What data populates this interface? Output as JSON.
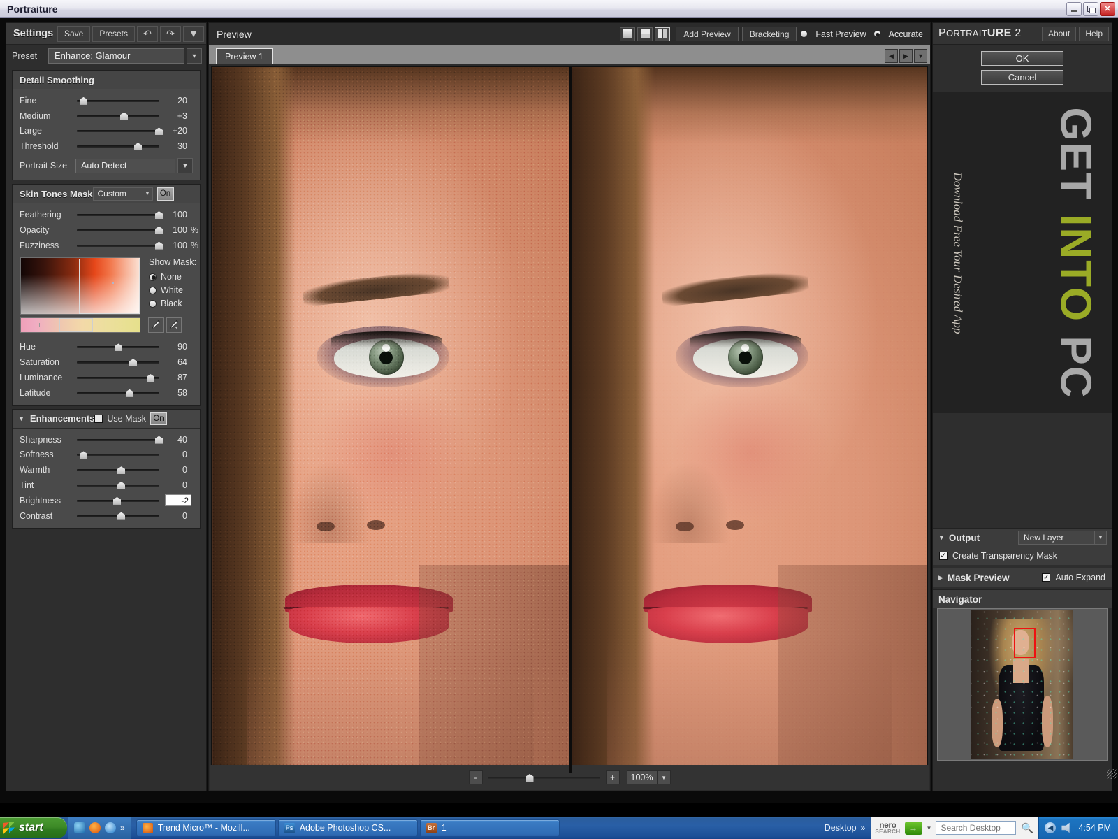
{
  "window": {
    "title": "Portraiture",
    "minimize_icon": "minimize-icon",
    "restore_icon": "restore-icon",
    "close_icon": "close-icon",
    "close_label": "✕"
  },
  "settings_panel": {
    "title": "Settings",
    "save_label": "Save",
    "presets_label": "Presets",
    "undo_icon": "↶",
    "redo_icon": "↷",
    "menu_icon": "▼",
    "preset_label": "Preset",
    "preset_value": "Enhance: Glamour",
    "detail_smoothing": {
      "title": "Detail Smoothing",
      "sliders": [
        {
          "label": "Fine",
          "value": "-20",
          "pos": 4
        },
        {
          "label": "Medium",
          "value": "+3",
          "pos": 62
        },
        {
          "label": "Large",
          "value": "+20",
          "pos": 112
        },
        {
          "label": "Threshold",
          "value": "30",
          "pos": 82
        }
      ],
      "portrait_size_label": "Portrait Size",
      "portrait_size_value": "Auto Detect"
    },
    "skin_tones_mask": {
      "title": "Skin Tones Mask",
      "mode": "Custom",
      "toggle": "On",
      "sliders": [
        {
          "label": "Feathering",
          "value": "100",
          "unit": "",
          "pos": 112
        },
        {
          "label": "Opacity",
          "value": "100",
          "unit": "%",
          "pos": 112
        },
        {
          "label": "Fuzziness",
          "value": "100",
          "unit": "%",
          "pos": 112
        }
      ],
      "show_mask_label": "Show Mask:",
      "show_mask_options": [
        {
          "label": "None",
          "selected": true
        },
        {
          "label": "White",
          "selected": false
        },
        {
          "label": "Black",
          "selected": false
        }
      ],
      "eyedropper_icon": "eyedropper-icon",
      "eyedropper_add_icon": "eyedropper-add-icon",
      "hsl_sliders": [
        {
          "label": "Hue",
          "value": "90",
          "pos": 54
        },
        {
          "label": "Saturation",
          "value": "64",
          "pos": 75
        },
        {
          "label": "Luminance",
          "value": "87",
          "pos": 100
        },
        {
          "label": "Latitude",
          "value": "58",
          "pos": 70
        }
      ]
    },
    "enhancements": {
      "title": "Enhancements",
      "use_mask_label": "Use Mask",
      "use_mask_checked": false,
      "toggle": "On",
      "sliders": [
        {
          "label": "Sharpness",
          "value": "40",
          "pos": 112,
          "editing": false
        },
        {
          "label": "Softness",
          "value": "0",
          "pos": 4,
          "editing": false
        },
        {
          "label": "Warmth",
          "value": "0",
          "pos": 58,
          "editing": false
        },
        {
          "label": "Tint",
          "value": "0",
          "pos": 58,
          "editing": false
        },
        {
          "label": "Brightness",
          "value": "-2",
          "pos": 52,
          "editing": true
        },
        {
          "label": "Contrast",
          "value": "0",
          "pos": 58,
          "editing": false
        }
      ]
    }
  },
  "preview_panel": {
    "title": "Preview",
    "view_single_icon": "view-single-icon",
    "view_horizontal_icon": "view-split-horizontal-icon",
    "view_vertical_icon": "view-split-vertical-icon",
    "add_preview_label": "Add Preview",
    "bracketing_label": "Bracketing",
    "fast_preview_label": "Fast Preview",
    "accurate_label": "Accurate",
    "quality_selected": "Accurate",
    "tab_label": "Preview 1",
    "nav_prev_icon": "◀",
    "nav_next_icon": "▶",
    "nav_menu_icon": "▼",
    "zoom_out_label": "-",
    "zoom_in_label": "+",
    "zoom_value": "100%",
    "zoom_dropdown_icon": "▼"
  },
  "right_panel": {
    "brand_part1": "P",
    "brand_part2": "ORTRAIT",
    "brand_part3": "URE",
    "brand_part4": " 2",
    "about_label": "About",
    "help_label": "Help",
    "ok_label": "OK",
    "cancel_label": "Cancel",
    "watermark": {
      "line_get": "GET",
      "line_into": "INTO",
      "line_pc": "PC",
      "tagline": "Download Free Your Desired App",
      "color_grey": "#a8a8a8",
      "color_green": "#9aab26"
    },
    "output": {
      "title": "Output",
      "value": "New Layer",
      "transparency_mask_label": "Create Transparency Mask",
      "transparency_mask_checked": true
    },
    "mask_preview": {
      "title": "Mask Preview",
      "auto_expand_label": "Auto Expand",
      "auto_expand_checked": true
    },
    "navigator": {
      "title": "Navigator"
    }
  },
  "taskbar": {
    "start_label": "start",
    "quick_launch_chevron": "»",
    "tasks": [
      {
        "icon": "firefox-icon",
        "label": "Trend Micro™ - Mozill..."
      },
      {
        "icon": "photoshop-icon",
        "badge": "Ps",
        "label": "Adobe Photoshop CS..."
      },
      {
        "icon": "bridge-icon",
        "badge": "Br",
        "label": "1"
      }
    ],
    "desktop_band_label": "Desktop",
    "desktop_band_chevron": "»",
    "nero_line1": "nero",
    "nero_line2": "SEARCH",
    "go_arrow_icon": "→",
    "search_placeholder": "Search Desktop",
    "search_value": "",
    "magnifier_icon": "⌕",
    "tray_show_icon": "◀",
    "tray_volume_icon": "volume-icon",
    "clock": "4:54 PM"
  }
}
